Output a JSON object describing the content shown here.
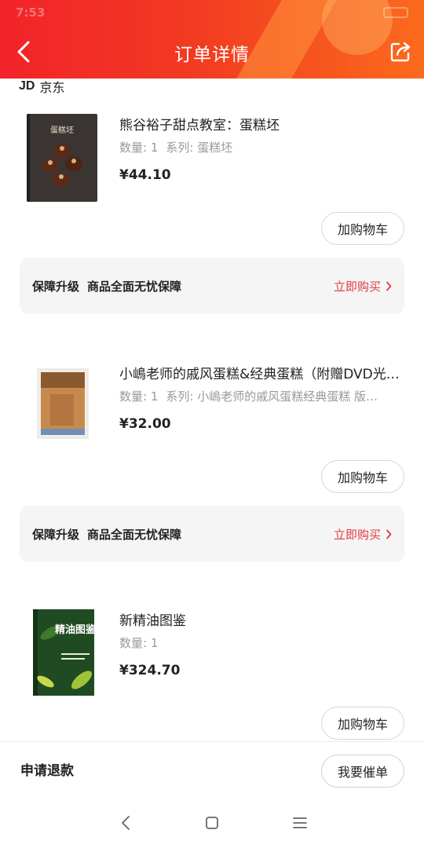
{
  "status_bar": {
    "time": "7:53"
  },
  "header": {
    "title": "订单详情"
  },
  "shop": {
    "logo": "JD",
    "name": "京东"
  },
  "items": [
    {
      "title": "熊谷裕子甜点教室：蛋糕坯",
      "quantity": "数量: 1",
      "series": "系列: 蛋糕坯",
      "price": "¥44.10",
      "cart_label": "加购物车",
      "cover_text": "蛋糕坯"
    },
    {
      "title": "小嶋老师的戚风蛋糕&经典蛋糕（附赠DVD光…",
      "quantity": "数量: 1",
      "series": "系列: 小嶋老师的戚风蛋糕经典蛋糕   版…",
      "price": "¥32.00",
      "cart_label": "加购物车"
    },
    {
      "title": "新精油图鉴",
      "quantity": "数量: 1",
      "series": "",
      "price": "¥324.70",
      "cart_label": "加购物车",
      "cover_text": "精油图鉴"
    }
  ],
  "guarantee": {
    "label1": "保障升级",
    "label2": "商品全面无忧保障",
    "action": "立即购买"
  },
  "bottom": {
    "refund_label": "申请退款",
    "urge_label": "我要催单"
  },
  "colors": {
    "header_start": "#f2232a",
    "header_end": "#fb6b1c",
    "accent_red": "#e4393c"
  },
  "icons": {
    "back": "chevron-left-icon",
    "share": "share-icon",
    "guarantee_arrow": "chevron-right-icon",
    "nav_back": "nav-back-icon",
    "nav_home": "nav-home-icon",
    "nav_menu": "nav-menu-icon"
  }
}
